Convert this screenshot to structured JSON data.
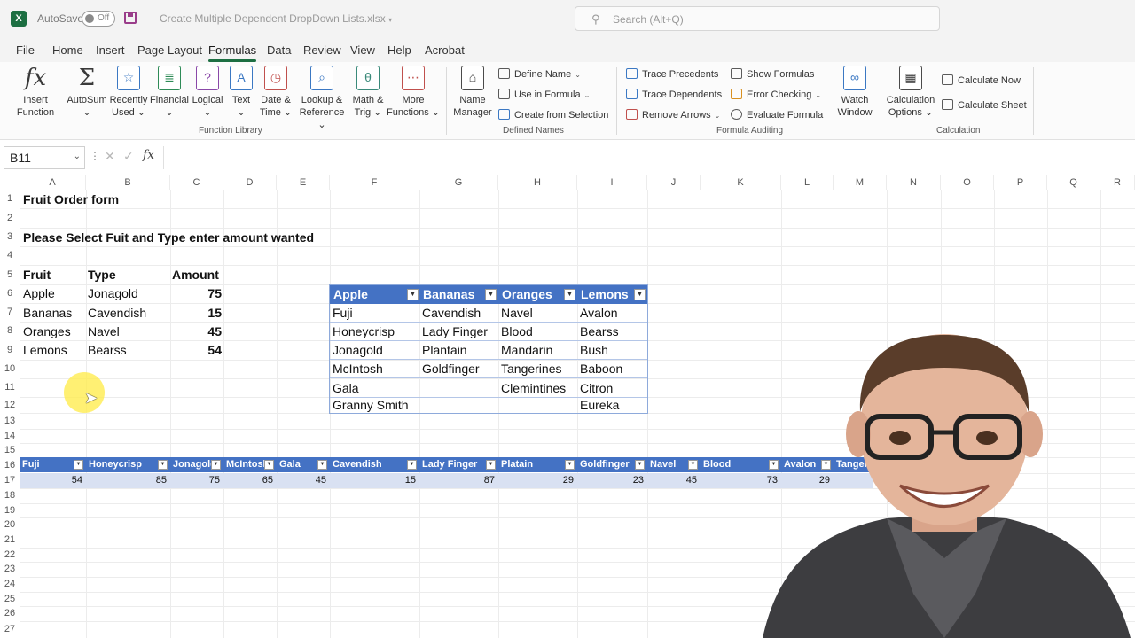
{
  "titlebar": {
    "app_logo": "X",
    "autosave_label": "AutoSave",
    "autosave_state": "Off",
    "filename": "Create Multiple Dependent DropDown Lists.xlsx",
    "search_placeholder": "Search (Alt+Q)"
  },
  "menu": {
    "tabs": [
      "File",
      "Home",
      "Insert",
      "Page Layout",
      "Formulas",
      "Data",
      "Review",
      "View",
      "Help",
      "Acrobat"
    ],
    "active": "Formulas"
  },
  "ribbon": {
    "function_library": {
      "label": "Function Library",
      "buttons": [
        {
          "line1": "Insert",
          "line2": "Function",
          "icon": "fx-icon"
        },
        {
          "line1": "AutoSum",
          "line2": "⌄",
          "icon": "sigma-icon"
        },
        {
          "line1": "Recently",
          "line2": "Used ⌄",
          "icon": "star-icon"
        },
        {
          "line1": "Financial",
          "line2": "⌄",
          "icon": "database-icon"
        },
        {
          "line1": "Logical",
          "line2": "⌄",
          "icon": "question-icon"
        },
        {
          "line1": "Text",
          "line2": "⌄",
          "icon": "text-icon"
        },
        {
          "line1": "Date &",
          "line2": "Time ⌄",
          "icon": "clock-icon"
        },
        {
          "line1": "Lookup &",
          "line2": "Reference ⌄",
          "icon": "magnifier-icon"
        },
        {
          "line1": "Math &",
          "line2": "Trig ⌄",
          "icon": "theta-icon"
        },
        {
          "line1": "More",
          "line2": "Functions ⌄",
          "icon": "more-icon"
        }
      ]
    },
    "defined_names": {
      "label": "Defined Names",
      "manager": {
        "line1": "Name",
        "line2": "Manager"
      },
      "items": [
        "Define Name",
        "Use in Formula",
        "Create from Selection"
      ]
    },
    "formula_auditing": {
      "label": "Formula Auditing",
      "left": [
        "Trace Precedents",
        "Trace Dependents",
        "Remove Arrows"
      ],
      "right": [
        "Show Formulas",
        "Error Checking",
        "Evaluate Formula"
      ],
      "watch": {
        "line1": "Watch",
        "line2": "Window"
      }
    },
    "calculation": {
      "label": "Calculation",
      "options": {
        "line1": "Calculation",
        "line2": "Options ⌄"
      },
      "items": [
        "Calculate Now",
        "Calculate Sheet"
      ]
    }
  },
  "formula_bar": {
    "name_box": "B11",
    "fx": "fx",
    "value": ""
  },
  "sheet": {
    "columns": [
      "A",
      "B",
      "C",
      "D",
      "E",
      "F",
      "G",
      "H",
      "I",
      "J",
      "K",
      "L",
      "M",
      "N",
      "O",
      "P",
      "Q",
      "R"
    ],
    "rows": [
      "1",
      "2",
      "3",
      "4",
      "5",
      "6",
      "7",
      "8",
      "9",
      "10",
      "11",
      "12",
      "13",
      "14",
      "15",
      "16",
      "17",
      "18",
      "19",
      "20",
      "21",
      "22",
      "23",
      "24",
      "25",
      "26",
      "27"
    ],
    "title": "Fruit Order form",
    "instruction": "Please Select Fuit and Type enter amount wanted",
    "order_headers": [
      "Fruit",
      "Type",
      "Amount"
    ],
    "orders": [
      {
        "fruit": "Apple",
        "type": "Jonagold",
        "amount": "75"
      },
      {
        "fruit": "Bananas",
        "type": "Cavendish",
        "amount": "15"
      },
      {
        "fruit": "Oranges",
        "type": "Navel",
        "amount": "45"
      },
      {
        "fruit": "Lemons",
        "type": "Bearss",
        "amount": "54"
      }
    ],
    "fruit_table": {
      "headers": [
        "Apple",
        "Bananas",
        "Oranges",
        "Lemons"
      ],
      "rows": [
        [
          "Fuji",
          "Cavendish",
          "Navel",
          "Avalon"
        ],
        [
          "Honeycrisp",
          "Lady Finger",
          "Blood",
          "Bearss"
        ],
        [
          "Jonagold",
          "Plantain",
          "Mandarin",
          "Bush"
        ],
        [
          "McIntosh",
          "Goldfinger",
          "Tangerines",
          "Baboon"
        ],
        [
          "Gala",
          "",
          "Clemintines",
          "Citron"
        ],
        [
          "Granny Smith",
          "",
          "",
          "Eureka"
        ]
      ]
    },
    "type_table": {
      "headers": [
        "Fuji",
        "Honeycrisp",
        "Jonagold",
        "McIntosh",
        "Gala",
        "Cavendish",
        "Lady Finger",
        "Platain",
        "Goldfinger",
        "Navel",
        "Blood",
        "Avalon",
        "Tangerines"
      ],
      "values": [
        "54",
        "85",
        "75",
        "65",
        "45",
        "15",
        "87",
        "29",
        "23",
        "45",
        "73",
        "29",
        ""
      ]
    }
  },
  "colors": {
    "excel_green": "#1d6f42",
    "table_header": "#4472c4",
    "table_band": "#d9e1f2",
    "cursor_highlight": "#ffec50"
  }
}
